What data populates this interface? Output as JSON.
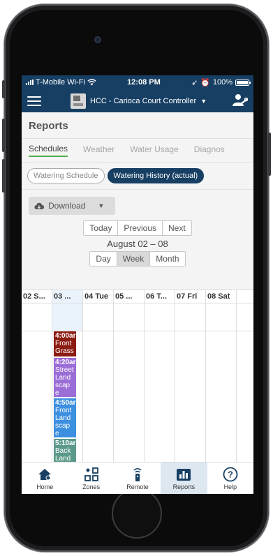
{
  "colors": {
    "header": "#173f63",
    "accent_green": "#4caf50",
    "event_front_grass": "#8b1c12",
    "event_street": "#9b6dd6",
    "event_front_land": "#3d8fe0",
    "event_back_land": "#5b9a8b"
  },
  "status_bar": {
    "carrier": "T-Mobile Wi-Fi",
    "time": "12:08 PM",
    "battery": "100%",
    "battery_level": 1.0
  },
  "header": {
    "menu_icon": "hamburger-icon",
    "controller": "HCC - Carioca Court Controller",
    "user_icon": "user-settings-icon"
  },
  "page": {
    "title": "Reports"
  },
  "tabs": [
    {
      "label": "Schedules",
      "active": true
    },
    {
      "label": "Weather",
      "active": false
    },
    {
      "label": "Water Usage",
      "active": false
    },
    {
      "label": "Diagnos",
      "active": false
    }
  ],
  "history_toggle": {
    "schedule": "Watering Schedule",
    "history": "Watering History (actual)"
  },
  "download": {
    "label": "Download",
    "icon": "cloud-download-icon"
  },
  "date_nav": {
    "today": "Today",
    "previous": "Previous",
    "next": "Next"
  },
  "date_range": "August 02 – 08",
  "views": {
    "day": "Day",
    "week": "Week",
    "month": "Month",
    "selected": "Week"
  },
  "calendar": {
    "columns": [
      "02 S...",
      "03 ...",
      "04 Tue",
      "05 ...",
      "06 T...",
      "07 Fri",
      "08 Sat"
    ],
    "events": [
      {
        "time": "4:00ar",
        "name": "Front Grass"
      },
      {
        "time": "4:20ar",
        "name": "Street Land scap e"
      },
      {
        "time": "4:50ar",
        "name": "Front Land scap e"
      },
      {
        "time": "5:10ar",
        "name": "Back Land"
      }
    ]
  },
  "bottom_nav": [
    {
      "label": "Home",
      "icon": "home-icon"
    },
    {
      "label": "Zones",
      "icon": "zones-icon"
    },
    {
      "label": "Remote",
      "icon": "remote-icon"
    },
    {
      "label": "Reports",
      "icon": "reports-icon",
      "active": true
    },
    {
      "label": "Help",
      "icon": "help-icon"
    }
  ]
}
